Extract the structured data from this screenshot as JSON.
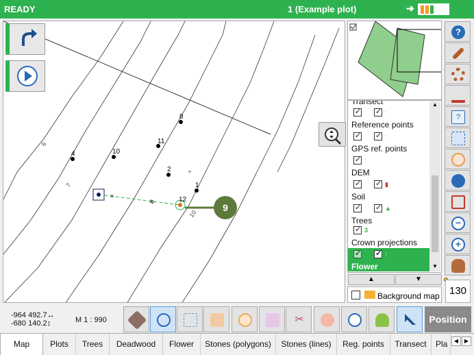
{
  "titlebar": {
    "status": "READY",
    "plot": "1 (Example plot)",
    "arrow": "➔"
  },
  "map": {
    "points": [
      {
        "label": "8"
      },
      {
        "label": "4"
      },
      {
        "label": "10"
      },
      {
        "label": "11"
      },
      {
        "label": "2"
      },
      {
        "label": "1"
      },
      {
        "label": "12"
      }
    ],
    "contour_labels": [
      "6",
      "7",
      "8",
      "10"
    ],
    "callout": "9"
  },
  "layers": {
    "partial_header": "Transect",
    "items": [
      {
        "label": "Reference points",
        "checked_a": true,
        "checked_b": true
      },
      {
        "label": "GPS ref. points",
        "checked_a": true,
        "checked_b": true
      },
      {
        "label": "DEM",
        "checked_a": true,
        "checked_b": false
      },
      {
        "label": "Soil",
        "checked_a": true,
        "checked_b": true
      },
      {
        "label": "Trees",
        "checked_a": true,
        "checked_b": true
      },
      {
        "label": "Crown projections",
        "checked_a": true,
        "checked_b": false
      },
      {
        "label": "Flower",
        "checked_a": true,
        "checked_b": true
      }
    ],
    "page_up": "▲",
    "page_down": "▼"
  },
  "background_map": {
    "label": "Background map",
    "checked": false
  },
  "slider_value": "130",
  "status": {
    "coord_x": "-964 492.7↔",
    "coord_y": "-680 140.2↕",
    "scale": "M 1 : 990"
  },
  "position_label": "Position",
  "tabs": [
    "Map",
    "Plots",
    "Trees",
    "Deadwood",
    "Flower",
    "Stones (polygons)",
    "Stones (lines)",
    "Reg. points",
    "Transect",
    "Pla"
  ],
  "colors": {
    "accent": "#2eb24f",
    "selected_layer": "#2eb24f",
    "overview_fill": "#8fce8c",
    "callout": "#5e7a3a"
  }
}
